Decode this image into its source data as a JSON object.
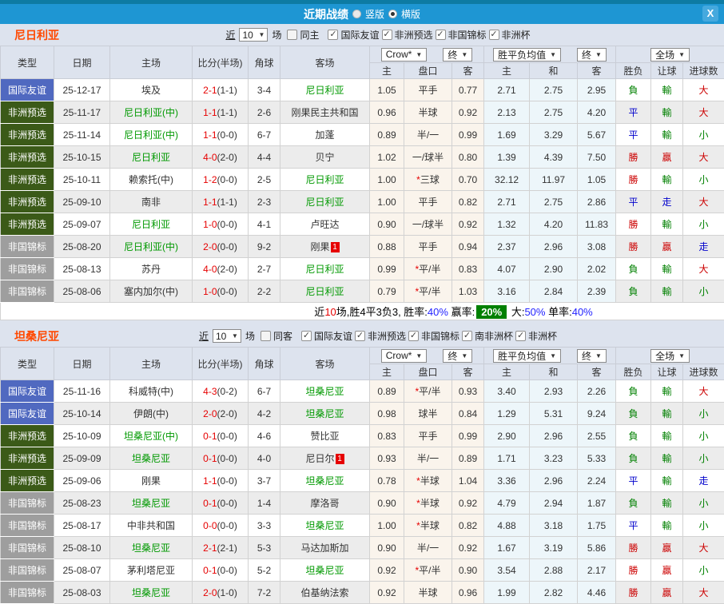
{
  "colors": {
    "titlebar_blue": "#1e96d3",
    "top_strip": "#0d7ba3",
    "section_bg": "#dde3ee",
    "team_name_orange": "#ff4800",
    "team_green": "#009900",
    "score_red": "#e60000",
    "type_friendly_bg": "#5069c0",
    "type_qualifier_bg": "#3b5a18",
    "type_championship_bg": "#9e9e9e",
    "handicap_col_bg": "#faf4ec",
    "avg_col_bg": "#edf6fa",
    "alt_row_bg": "#ececec",
    "win_red": "#cc0000",
    "draw_blue": "#0000cc",
    "loss_green": "#008000",
    "summary_box_green": "#008000"
  },
  "titlebar": {
    "title": "近期战绩",
    "vertical_label": "竖版",
    "horizontal_label": "横版",
    "close_icon": "X"
  },
  "table_header": {
    "type": "类型",
    "date": "日期",
    "home": "主场",
    "score": "比分(半场)",
    "corner": "角球",
    "away": "客场",
    "dd_crow": "Crow*",
    "dd_final1": "终",
    "dd_avg": "胜平负均值",
    "dd_final2": "终",
    "dd_full": "全场",
    "sub_home": "主",
    "sub_handicap": "盘口",
    "sub_away": "客",
    "sub_avg_home": "主",
    "sub_avg_draw": "和",
    "sub_avg_away": "客",
    "result": "胜负",
    "handicap_result": "让球",
    "goals": "进球数"
  },
  "sections": [
    {
      "team": "尼日利亚",
      "filter": {
        "near_label": "近",
        "count": "10",
        "games_label": "场",
        "same": {
          "label": "同主",
          "checked": false
        },
        "comps": [
          {
            "label": "国际友谊",
            "checked": true
          },
          {
            "label": "非洲预选",
            "checked": true
          },
          {
            "label": "非国锦标",
            "checked": true
          },
          {
            "label": "非洲杯",
            "checked": true
          }
        ]
      },
      "rows": [
        {
          "type": "国际友谊",
          "type_key": "friendly",
          "date": "25-12-17",
          "home": "埃及",
          "home_green": false,
          "home_card": "",
          "score": "2-1",
          "half": "(1-1)",
          "corners": "3-4",
          "away": "尼日利亚",
          "away_green": true,
          "away_card": "",
          "odds_home": "1.05",
          "handicap_star": "",
          "handicap": "平手",
          "odds_away": "0.77",
          "avg_home": "2.71",
          "avg_draw": "2.75",
          "avg_away": "2.95",
          "result": "負",
          "result_c": "green",
          "bet": "輸",
          "bet_c": "green",
          "goals": "大",
          "goals_c": "red"
        },
        {
          "type": "非洲预选",
          "type_key": "qual",
          "date": "25-11-17",
          "home": "尼日利亚(中)",
          "home_green": true,
          "home_card": "",
          "score": "1-1",
          "half": "(1-1)",
          "corners": "2-6",
          "away": "刚果民主共和国",
          "away_green": false,
          "away_card": "",
          "odds_home": "0.96",
          "handicap_star": "",
          "handicap": "半球",
          "odds_away": "0.92",
          "avg_home": "2.13",
          "avg_draw": "2.75",
          "avg_away": "4.20",
          "result": "平",
          "result_c": "blue",
          "bet": "輸",
          "bet_c": "green",
          "goals": "大",
          "goals_c": "red"
        },
        {
          "type": "非洲预选",
          "type_key": "qual",
          "date": "25-11-14",
          "home": "尼日利亚(中)",
          "home_green": true,
          "home_card": "",
          "score": "1-1",
          "half": "(0-0)",
          "corners": "6-7",
          "away": "加蓬",
          "away_green": false,
          "away_card": "",
          "odds_home": "0.89",
          "handicap_star": "",
          "handicap": "半/一",
          "odds_away": "0.99",
          "avg_home": "1.69",
          "avg_draw": "3.29",
          "avg_away": "5.67",
          "result": "平",
          "result_c": "blue",
          "bet": "輸",
          "bet_c": "green",
          "goals": "小",
          "goals_c": "green"
        },
        {
          "type": "非洲预选",
          "type_key": "qual",
          "date": "25-10-15",
          "home": "尼日利亚",
          "home_green": true,
          "home_card": "",
          "score": "4-0",
          "half": "(2-0)",
          "corners": "4-4",
          "away": "贝宁",
          "away_green": false,
          "away_card": "",
          "odds_home": "1.02",
          "handicap_star": "",
          "handicap": "一/球半",
          "odds_away": "0.80",
          "avg_home": "1.39",
          "avg_draw": "4.39",
          "avg_away": "7.50",
          "result": "勝",
          "result_c": "red",
          "bet": "贏",
          "bet_c": "red",
          "goals": "大",
          "goals_c": "red"
        },
        {
          "type": "非洲预选",
          "type_key": "qual",
          "date": "25-10-11",
          "home": "赖索托(中)",
          "home_green": false,
          "home_card": "",
          "score": "1-2",
          "half": "(0-0)",
          "corners": "2-5",
          "away": "尼日利亚",
          "away_green": true,
          "away_card": "",
          "odds_home": "1.00",
          "handicap_star": "*",
          "handicap": "三球",
          "odds_away": "0.70",
          "avg_home": "32.12",
          "avg_draw": "11.97",
          "avg_away": "1.05",
          "result": "勝",
          "result_c": "red",
          "bet": "輸",
          "bet_c": "green",
          "goals": "小",
          "goals_c": "green"
        },
        {
          "type": "非洲预选",
          "type_key": "qual",
          "date": "25-09-10",
          "home": "南非",
          "home_green": false,
          "home_card": "",
          "score": "1-1",
          "half": "(1-1)",
          "corners": "2-3",
          "away": "尼日利亚",
          "away_green": true,
          "away_card": "",
          "odds_home": "1.00",
          "handicap_star": "",
          "handicap": "平手",
          "odds_away": "0.82",
          "avg_home": "2.71",
          "avg_draw": "2.75",
          "avg_away": "2.86",
          "result": "平",
          "result_c": "blue",
          "bet": "走",
          "bet_c": "blue",
          "goals": "大",
          "goals_c": "red"
        },
        {
          "type": "非洲预选",
          "type_key": "qual",
          "date": "25-09-07",
          "home": "尼日利亚",
          "home_green": true,
          "home_card": "",
          "score": "1-0",
          "half": "(0-0)",
          "corners": "4-1",
          "away": "卢旺达",
          "away_green": false,
          "away_card": "",
          "odds_home": "0.90",
          "handicap_star": "",
          "handicap": "一/球半",
          "odds_away": "0.92",
          "avg_home": "1.32",
          "avg_draw": "4.20",
          "avg_away": "11.83",
          "result": "勝",
          "result_c": "red",
          "bet": "輸",
          "bet_c": "green",
          "goals": "小",
          "goals_c": "green"
        },
        {
          "type": "非国锦标",
          "type_key": "chan",
          "date": "25-08-20",
          "home": "尼日利亚(中)",
          "home_green": true,
          "home_card": "",
          "score": "2-0",
          "half": "(0-0)",
          "corners": "9-2",
          "away": "刚果",
          "away_green": false,
          "away_card": "1",
          "odds_home": "0.88",
          "handicap_star": "",
          "handicap": "平手",
          "odds_away": "0.94",
          "avg_home": "2.37",
          "avg_draw": "2.96",
          "avg_away": "3.08",
          "result": "勝",
          "result_c": "red",
          "bet": "贏",
          "bet_c": "red",
          "goals": "走",
          "goals_c": "blue"
        },
        {
          "type": "非国锦标",
          "type_key": "chan",
          "date": "25-08-13",
          "home": "苏丹",
          "home_green": false,
          "home_card": "",
          "score": "4-0",
          "half": "(2-0)",
          "corners": "2-7",
          "away": "尼日利亚",
          "away_green": true,
          "away_card": "",
          "odds_home": "0.99",
          "handicap_star": "*",
          "handicap": "平/半",
          "odds_away": "0.83",
          "avg_home": "4.07",
          "avg_draw": "2.90",
          "avg_away": "2.02",
          "result": "負",
          "result_c": "green",
          "bet": "輸",
          "bet_c": "green",
          "goals": "大",
          "goals_c": "red"
        },
        {
          "type": "非国锦标",
          "type_key": "chan",
          "date": "25-08-06",
          "home": "塞内加尔(中)",
          "home_green": false,
          "home_card": "",
          "score": "1-0",
          "half": "(0-0)",
          "corners": "2-2",
          "away": "尼日利亚",
          "away_green": true,
          "away_card": "",
          "odds_home": "0.79",
          "handicap_star": "*",
          "handicap": "平/半",
          "odds_away": "1.03",
          "avg_home": "3.16",
          "avg_draw": "2.84",
          "avg_away": "2.39",
          "result": "負",
          "result_c": "green",
          "bet": "輸",
          "bet_c": "green",
          "goals": "小",
          "goals_c": "green"
        }
      ],
      "summary": {
        "parts": [
          {
            "t": "近"
          },
          {
            "t": "10"
          },
          {
            "t": "场,胜4平3负3, 胜率:"
          },
          {
            "t": "40%"
          },
          {
            "t": " 赢率:"
          },
          {
            "t": "20%"
          },
          {
            "t": " 大:"
          },
          {
            "t": "50%"
          },
          {
            "t": " 单率:"
          },
          {
            "t": "40%"
          }
        ]
      }
    },
    {
      "team": "坦桑尼亚",
      "filter": {
        "near_label": "近",
        "count": "10",
        "games_label": "场",
        "same": {
          "label": "同客",
          "checked": false
        },
        "comps": [
          {
            "label": "国际友谊",
            "checked": true
          },
          {
            "label": "非洲预选",
            "checked": true
          },
          {
            "label": "非国锦标",
            "checked": true
          },
          {
            "label": "南非洲杯",
            "checked": true
          },
          {
            "label": "非洲杯",
            "checked": true
          }
        ]
      },
      "rows": [
        {
          "type": "国际友谊",
          "type_key": "friendly",
          "date": "25-11-16",
          "home": "科威特(中)",
          "home_green": false,
          "home_card": "",
          "score": "4-3",
          "half": "(0-2)",
          "corners": "6-7",
          "away": "坦桑尼亚",
          "away_green": true,
          "away_card": "",
          "odds_home": "0.89",
          "handicap_star": "*",
          "handicap": "平/半",
          "odds_away": "0.93",
          "avg_home": "3.40",
          "avg_draw": "2.93",
          "avg_away": "2.26",
          "result": "負",
          "result_c": "green",
          "bet": "輸",
          "bet_c": "green",
          "goals": "大",
          "goals_c": "red"
        },
        {
          "type": "国际友谊",
          "type_key": "friendly",
          "date": "25-10-14",
          "home": "伊朗(中)",
          "home_green": false,
          "home_card": "",
          "score": "2-0",
          "half": "(2-0)",
          "corners": "4-2",
          "away": "坦桑尼亚",
          "away_green": true,
          "away_card": "",
          "odds_home": "0.98",
          "handicap_star": "",
          "handicap": "球半",
          "odds_away": "0.84",
          "avg_home": "1.29",
          "avg_draw": "5.31",
          "avg_away": "9.24",
          "result": "負",
          "result_c": "green",
          "bet": "輸",
          "bet_c": "green",
          "goals": "小",
          "goals_c": "green"
        },
        {
          "type": "非洲预选",
          "type_key": "qual",
          "date": "25-10-09",
          "home": "坦桑尼亚(中)",
          "home_green": true,
          "home_card": "",
          "score": "0-1",
          "half": "(0-0)",
          "corners": "4-6",
          "away": "赞比亚",
          "away_green": false,
          "away_card": "",
          "odds_home": "0.83",
          "handicap_star": "",
          "handicap": "平手",
          "odds_away": "0.99",
          "avg_home": "2.90",
          "avg_draw": "2.96",
          "avg_away": "2.55",
          "result": "負",
          "result_c": "green",
          "bet": "輸",
          "bet_c": "green",
          "goals": "小",
          "goals_c": "green"
        },
        {
          "type": "非洲预选",
          "type_key": "qual",
          "date": "25-09-09",
          "home": "坦桑尼亚",
          "home_green": true,
          "home_card": "",
          "score": "0-1",
          "half": "(0-0)",
          "corners": "4-0",
          "away": "尼日尔",
          "away_green": false,
          "away_card": "1",
          "odds_home": "0.93",
          "handicap_star": "",
          "handicap": "半/一",
          "odds_away": "0.89",
          "avg_home": "1.71",
          "avg_draw": "3.23",
          "avg_away": "5.33",
          "result": "負",
          "result_c": "green",
          "bet": "輸",
          "bet_c": "green",
          "goals": "小",
          "goals_c": "green"
        },
        {
          "type": "非洲预选",
          "type_key": "qual",
          "date": "25-09-06",
          "home": "刚果",
          "home_green": false,
          "home_card": "",
          "score": "1-1",
          "half": "(0-0)",
          "corners": "3-7",
          "away": "坦桑尼亚",
          "away_green": true,
          "away_card": "",
          "odds_home": "0.78",
          "handicap_star": "*",
          "handicap": "半球",
          "odds_away": "1.04",
          "avg_home": "3.36",
          "avg_draw": "2.96",
          "avg_away": "2.24",
          "result": "平",
          "result_c": "blue",
          "bet": "輸",
          "bet_c": "green",
          "goals": "走",
          "goals_c": "blue"
        },
        {
          "type": "非国锦标",
          "type_key": "chan",
          "date": "25-08-23",
          "home": "坦桑尼亚",
          "home_green": true,
          "home_card": "",
          "score": "0-1",
          "half": "(0-0)",
          "corners": "1-4",
          "away": "摩洛哥",
          "away_green": false,
          "away_card": "",
          "odds_home": "0.90",
          "handicap_star": "*",
          "handicap": "半球",
          "odds_away": "0.92",
          "avg_home": "4.79",
          "avg_draw": "2.94",
          "avg_away": "1.87",
          "result": "負",
          "result_c": "green",
          "bet": "輸",
          "bet_c": "green",
          "goals": "小",
          "goals_c": "green"
        },
        {
          "type": "非国锦标",
          "type_key": "chan",
          "date": "25-08-17",
          "home": "中非共和国",
          "home_green": false,
          "home_card": "",
          "score": "0-0",
          "half": "(0-0)",
          "corners": "3-3",
          "away": "坦桑尼亚",
          "away_green": true,
          "away_card": "",
          "odds_home": "1.00",
          "handicap_star": "*",
          "handicap": "半球",
          "odds_away": "0.82",
          "avg_home": "4.88",
          "avg_draw": "3.18",
          "avg_away": "1.75",
          "result": "平",
          "result_c": "blue",
          "bet": "輸",
          "bet_c": "green",
          "goals": "小",
          "goals_c": "green"
        },
        {
          "type": "非国锦标",
          "type_key": "chan",
          "date": "25-08-10",
          "home": "坦桑尼亚",
          "home_green": true,
          "home_card": "",
          "score": "2-1",
          "half": "(2-1)",
          "corners": "5-3",
          "away": "马达加斯加",
          "away_green": false,
          "away_card": "",
          "odds_home": "0.90",
          "handicap_star": "",
          "handicap": "半/一",
          "odds_away": "0.92",
          "avg_home": "1.67",
          "avg_draw": "3.19",
          "avg_away": "5.86",
          "result": "勝",
          "result_c": "red",
          "bet": "贏",
          "bet_c": "red",
          "goals": "大",
          "goals_c": "red"
        },
        {
          "type": "非国锦标",
          "type_key": "chan",
          "date": "25-08-07",
          "home": "茅利塔尼亚",
          "home_green": false,
          "home_card": "",
          "score": "0-1",
          "half": "(0-0)",
          "corners": "5-2",
          "away": "坦桑尼亚",
          "away_green": true,
          "away_card": "",
          "odds_home": "0.92",
          "handicap_star": "*",
          "handicap": "平/半",
          "odds_away": "0.90",
          "avg_home": "3.54",
          "avg_draw": "2.88",
          "avg_away": "2.17",
          "result": "勝",
          "result_c": "red",
          "bet": "贏",
          "bet_c": "red",
          "goals": "小",
          "goals_c": "green"
        },
        {
          "type": "非国锦标",
          "type_key": "chan",
          "date": "25-08-03",
          "home": "坦桑尼亚",
          "home_green": true,
          "home_card": "",
          "score": "2-0",
          "half": "(1-0)",
          "corners": "7-2",
          "away": "伯基纳法索",
          "away_green": false,
          "away_card": "",
          "odds_home": "0.92",
          "handicap_star": "",
          "handicap": "半球",
          "odds_away": "0.96",
          "avg_home": "1.99",
          "avg_draw": "2.82",
          "avg_away": "4.46",
          "result": "勝",
          "result_c": "red",
          "bet": "贏",
          "bet_c": "red",
          "goals": "大",
          "goals_c": "red"
        }
      ]
    }
  ]
}
